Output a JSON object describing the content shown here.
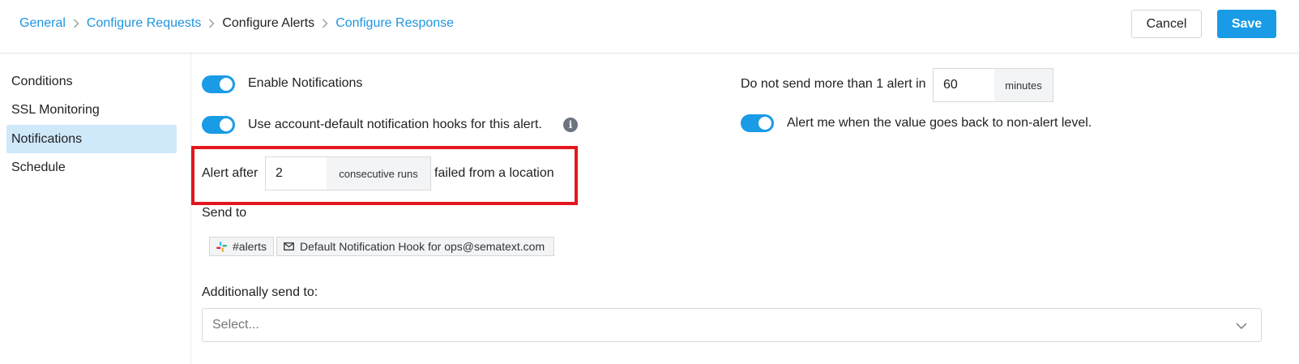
{
  "breadcrumb": [
    {
      "label": "General"
    },
    {
      "label": "Configure Requests"
    },
    {
      "label": "Configure Alerts"
    },
    {
      "label": "Configure Response"
    }
  ],
  "header": {
    "cancel_label": "Cancel",
    "save_label": "Save"
  },
  "sidebar": {
    "items": [
      {
        "label": "Conditions"
      },
      {
        "label": "SSL Monitoring"
      },
      {
        "label": "Notifications"
      },
      {
        "label": "Schedule"
      }
    ],
    "active": "Notifications"
  },
  "notifications": {
    "enable_label": "Enable Notifications",
    "enable_on": true,
    "default_hooks_label": "Use account-default notification hooks for this alert.",
    "default_hooks_on": true,
    "alert_after_prefix": "Alert after",
    "alert_after_value": "2",
    "alert_after_addon": "consecutive runs",
    "alert_after_suffix": "failed from a location",
    "send_to_label": "Send to",
    "send_to_chips": [
      {
        "icon": "slack-icon",
        "label": "#alerts"
      },
      {
        "icon": "envelope-icon",
        "label": "Default Notification Hook for ops@sematext.com"
      }
    ],
    "additionally_label": "Additionally send to:",
    "additionally_placeholder": "Select...",
    "rate_limit_prefix": "Do not send more than 1 alert in",
    "rate_limit_value": "60",
    "rate_limit_unit": "minutes",
    "recovery_label": "Alert me when the value goes back to non-alert level.",
    "recovery_on": true
  },
  "colors": {
    "accent": "#1a9be6",
    "link": "#1e95e0",
    "highlight_border": "#e3161e",
    "active_sidebar": "#cfe9fb"
  }
}
